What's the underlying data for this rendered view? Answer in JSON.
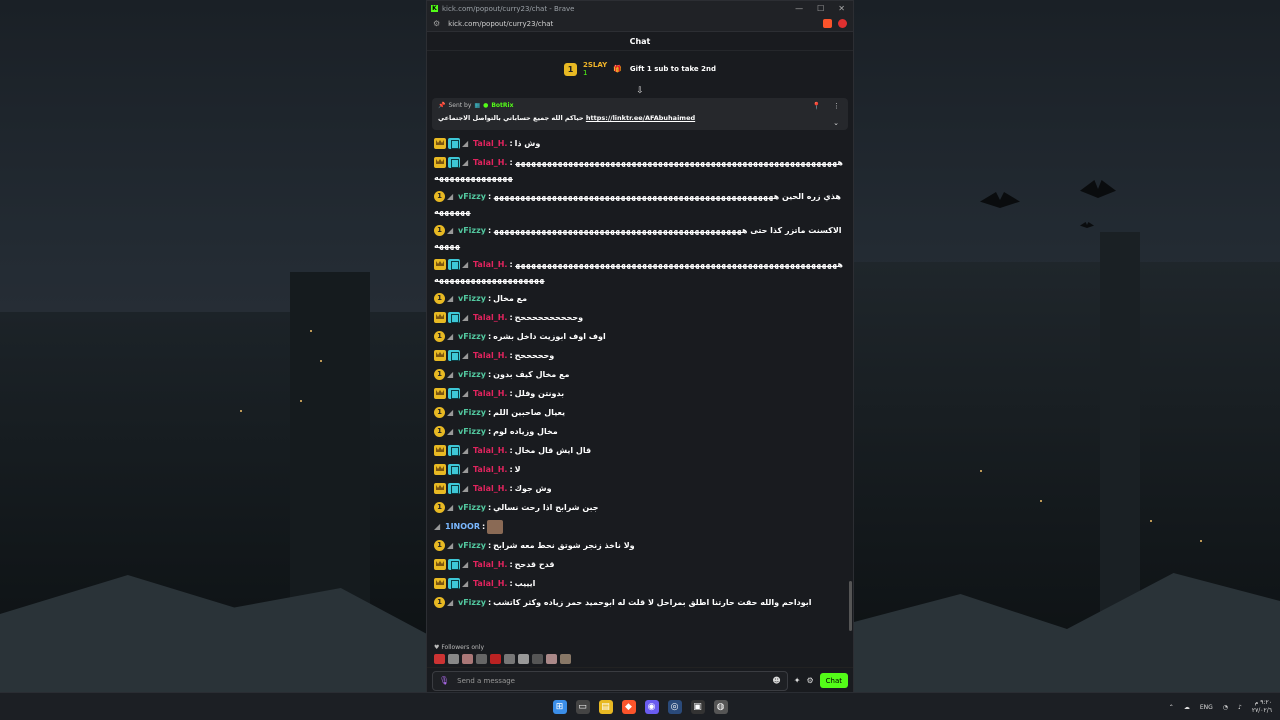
{
  "browser": {
    "title": "kick.com/popout/curry23/chat - Brave",
    "url": "kick.com/popout/curry23/chat",
    "controls": [
      "—",
      "☐",
      "✕"
    ]
  },
  "chat": {
    "header": "Chat",
    "gift": {
      "badge": "1",
      "user": "2SLAY",
      "count": "1",
      "text": "Gift 1 sub to take 2nd"
    },
    "pinned": {
      "sent_by_label": "Sent by",
      "bot": "BotRix",
      "message": "حياكم الله جميع حساباتي بالتواصل الاجتماعي",
      "link": "https://linktr.ee/AFAbuhaimed"
    },
    "messages": [
      {
        "user": "Talal_H.",
        "type": "talal",
        "text": "وش ذا",
        "wrap": false
      },
      {
        "user": "Talal_H.",
        "type": "talal",
        "text": "ههههههههههههههههههههههههههههههههههههههههههههههههههههههههههههههههههههههههههههه",
        "wrap": true
      },
      {
        "user": "vFizzy",
        "type": "vfizzy",
        "text": "هذي زره الحين ههههههههههههههههههههههههههههههههههههههههههههههههههههههههههههه",
        "wrap": true
      },
      {
        "user": "vFizzy",
        "type": "vfizzy",
        "text": "الاكسنت ماتزر كذا حتى ههههههههههههههههههههههههههههههههههههههههههههههههههههه",
        "wrap": true
      },
      {
        "user": "Talal_H.",
        "type": "talal",
        "text": "ههههههههههههههههههههههههههههههههههههههههههههههههههههههههههههههههههههههههههههههههههه",
        "wrap": true
      },
      {
        "user": "vFizzy",
        "type": "vfizzy",
        "text": "مع مخال",
        "wrap": false
      },
      {
        "user": "Talal_H.",
        "type": "talal",
        "text": "وححححححححححح",
        "wrap": false
      },
      {
        "user": "vFizzy",
        "type": "vfizzy",
        "text": "اوف اوف ابوزيت داخل بشره",
        "wrap": false
      },
      {
        "user": "Talal_H.",
        "type": "talal",
        "text": "وحححححح",
        "wrap": false
      },
      {
        "user": "vFizzy",
        "type": "vfizzy",
        "text": "مع مخال كيف بدون",
        "wrap": false
      },
      {
        "user": "Talal_H.",
        "type": "talal",
        "text": "بدونتن وفلل",
        "wrap": false
      },
      {
        "user": "vFizzy",
        "type": "vfizzy",
        "text": "يعيال صاحبين اللم",
        "wrap": false
      },
      {
        "user": "vFizzy",
        "type": "vfizzy",
        "text": "مخال وزياده لوم",
        "wrap": false
      },
      {
        "user": "Talal_H.",
        "type": "talal",
        "text": "قال ايش قال مخال",
        "wrap": false
      },
      {
        "user": "Talal_H.",
        "type": "talal",
        "text": "لا",
        "wrap": false
      },
      {
        "user": "Talal_H.",
        "type": "talal",
        "text": "وش جوك",
        "wrap": false
      },
      {
        "user": "vFizzy",
        "type": "vfizzy",
        "text": "جبن شرابح اذا رحت نسالي",
        "wrap": false
      },
      {
        "user": "1INOOR",
        "type": "inoor",
        "text": "",
        "wrap": false
      },
      {
        "user": "vFizzy",
        "type": "vfizzy",
        "text": "ولا ناخذ زنجر شوتق نحط معه شرابح",
        "wrap": false
      },
      {
        "user": "Talal_H.",
        "type": "talal",
        "text": "قدح قدحح",
        "wrap": false
      },
      {
        "user": "Talal_H.",
        "type": "talal",
        "text": "ايييب",
        "wrap": false
      },
      {
        "user": "vFizzy",
        "type": "vfizzy",
        "text": "ابوداحم والله حقت حارتنا اطلق بمراحل لا قلت له ابوحميد حمر زياده وكثر كاتشب",
        "wrap": false
      }
    ],
    "followers_label": "Followers only",
    "input_placeholder": "Send a message",
    "send_label": "Chat"
  },
  "taskbar": {
    "lang": "ENG",
    "time": "٩:٢٠ م",
    "date": "٢٧/٠٢/٦"
  }
}
